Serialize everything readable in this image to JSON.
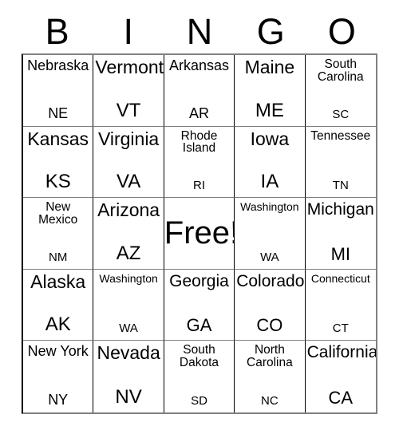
{
  "card": {
    "header_letters": [
      "B",
      "I",
      "N",
      "G",
      "O"
    ],
    "free_label": "Free!",
    "rows": [
      [
        {
          "name": "Nebraska",
          "abbr": "NE",
          "name_size": "md",
          "abbr_size": "md"
        },
        {
          "name": "Vermont",
          "abbr": "VT",
          "name_size": "xl",
          "abbr_size": "xl"
        },
        {
          "name": "Arkansas",
          "abbr": "AR",
          "name_size": "md",
          "abbr_size": "md"
        },
        {
          "name": "Maine",
          "abbr": "ME",
          "name_size": "xl",
          "abbr_size": "xl"
        },
        {
          "name": "South Carolina",
          "abbr": "SC",
          "name_size": "sm",
          "abbr_size": "sm"
        }
      ],
      [
        {
          "name": "Kansas",
          "abbr": "KS",
          "name_size": "xl",
          "abbr_size": "xl"
        },
        {
          "name": "Virginia",
          "abbr": "VA",
          "name_size": "xl",
          "abbr_size": "xl"
        },
        {
          "name": "Rhode Island",
          "abbr": "RI",
          "name_size": "sm",
          "abbr_size": "sm"
        },
        {
          "name": "Iowa",
          "abbr": "IA",
          "name_size": "xl",
          "abbr_size": "xl"
        },
        {
          "name": "Tennessee",
          "abbr": "TN",
          "name_size": "sm",
          "abbr_size": "sm"
        }
      ],
      [
        {
          "name": "New Mexico",
          "abbr": "NM",
          "name_size": "sm",
          "abbr_size": "sm"
        },
        {
          "name": "Arizona",
          "abbr": "AZ",
          "name_size": "xl",
          "abbr_size": "xl"
        },
        {
          "name": "Free!",
          "abbr": "",
          "name_size": "free",
          "abbr_size": "free"
        },
        {
          "name": "Washington",
          "abbr": "WA",
          "name_size": "xs",
          "abbr_size": "sm"
        },
        {
          "name": "Michigan",
          "abbr": "MI",
          "name_size": "lg",
          "abbr_size": "lg"
        }
      ],
      [
        {
          "name": "Alaska",
          "abbr": "AK",
          "name_size": "xl",
          "abbr_size": "xl"
        },
        {
          "name": "Washington",
          "abbr": "WA",
          "name_size": "xs",
          "abbr_size": "sm"
        },
        {
          "name": "Georgia",
          "abbr": "GA",
          "name_size": "lg",
          "abbr_size": "lg"
        },
        {
          "name": "Colorado",
          "abbr": "CO",
          "name_size": "lg",
          "abbr_size": "lg"
        },
        {
          "name": "Connecticut",
          "abbr": "CT",
          "name_size": "xs",
          "abbr_size": "sm"
        }
      ],
      [
        {
          "name": "New York",
          "abbr": "NY",
          "name_size": "md",
          "abbr_size": "md"
        },
        {
          "name": "Nevada",
          "abbr": "NV",
          "name_size": "xl",
          "abbr_size": "xl"
        },
        {
          "name": "South Dakota",
          "abbr": "SD",
          "name_size": "sm",
          "abbr_size": "sm"
        },
        {
          "name": "North Carolina",
          "abbr": "NC",
          "name_size": "sm",
          "abbr_size": "sm"
        },
        {
          "name": "California",
          "abbr": "CA",
          "name_size": "lg",
          "abbr_size": "lg"
        }
      ]
    ]
  },
  "colors": {
    "background": "#ffffff",
    "text": "#000000",
    "border_dark": "#000000",
    "border_light": "#808080"
  }
}
